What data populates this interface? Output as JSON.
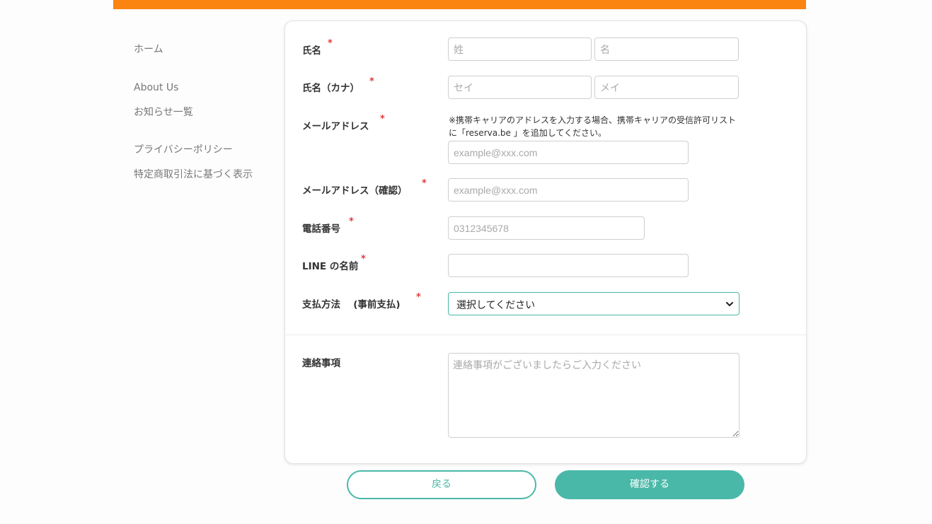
{
  "colors": {
    "accent_bar": "#fb8410",
    "primary": "#4ab8a8",
    "required": "#e03b3b"
  },
  "sidebar": {
    "items": [
      {
        "label": "ホーム"
      },
      {
        "label": "About Us"
      },
      {
        "label": "お知らせ一覧"
      },
      {
        "label": "プライバシーポリシー"
      },
      {
        "label": "特定商取引法に基づく表示"
      }
    ]
  },
  "form": {
    "required_mark": "*",
    "name": {
      "label": "氏名",
      "last_placeholder": "姓",
      "first_placeholder": "名"
    },
    "kana": {
      "label": "氏名（カナ）",
      "last_placeholder": "セイ",
      "first_placeholder": "メイ"
    },
    "email": {
      "label": "メールアドレス",
      "note": "※携帯キャリアのアドレスを入力する場合、携帯キャリアの受信許可リストに「reserva.be 」を追加してください。",
      "placeholder": "example@xxx.com"
    },
    "email_confirm": {
      "label": "メールアドレス（確認）",
      "placeholder": "example@xxx.com"
    },
    "phone": {
      "label": "電話番号",
      "placeholder": "0312345678"
    },
    "line_name": {
      "label": "LINE の名前",
      "value": ""
    },
    "payment": {
      "label": "支払方法　 (事前支払)",
      "selected": "選択してください"
    },
    "contact": {
      "label": "連絡事項",
      "placeholder": "連絡事項がございましたらご入力ください"
    }
  },
  "buttons": {
    "back": "戻る",
    "confirm": "確認する"
  }
}
